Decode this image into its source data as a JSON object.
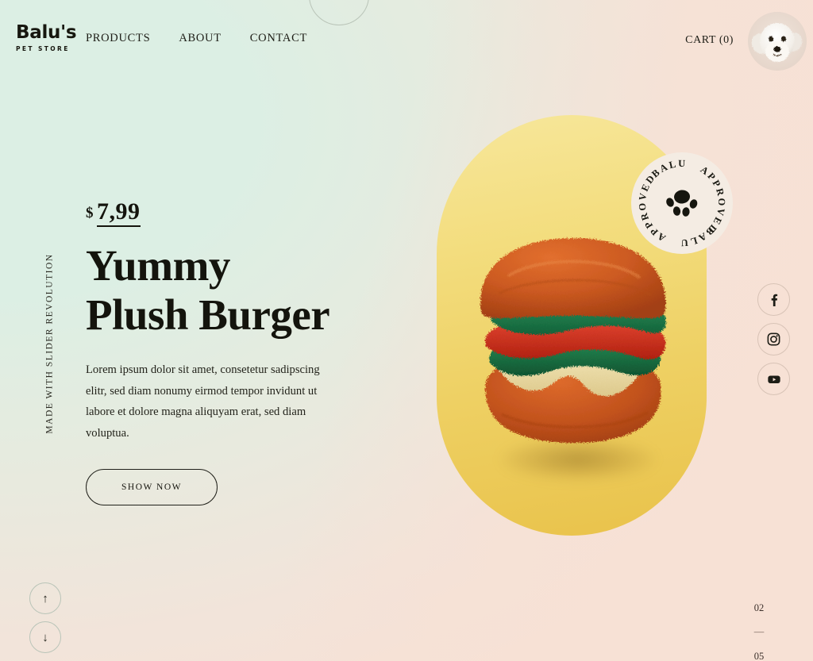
{
  "brand": {
    "logo_main": "Balu's",
    "logo_sub": "PET STORE",
    "paw_icon": "paw-icon"
  },
  "header": {
    "nav": [
      {
        "label": "PRODUCTS"
      },
      {
        "label": "ABOUT"
      },
      {
        "label": "CONTACT"
      }
    ],
    "cart_label": "CART (0)",
    "avatar_alt": "dog-avatar"
  },
  "hero": {
    "side_label": "MADE WITH SLIDER REVOLUTION",
    "currency": "$",
    "price": "7,99",
    "title_line1": "Yummy",
    "title_line2": "Plush Burger",
    "description": "Lorem ipsum dolor sit amet, consetetur sadipscing elitr, sed diam nonumy eirmod tempor invidunt ut labore et dolore magna aliquyam erat, sed diam voluptua.",
    "cta_label": "SHOW NOW",
    "product_alt": "plush-burger-toy"
  },
  "badge": {
    "ring_text": "BALU  •  APPROVED  •  BALU  •  APPROVED  •",
    "ring_word_1": "BALU",
    "ring_word_2": "APPROVED",
    "center_icon": "paw-icon"
  },
  "social": [
    {
      "name": "facebook",
      "glyph": "f"
    },
    {
      "name": "instagram",
      "glyph": "instagram-icon"
    },
    {
      "name": "youtube",
      "glyph": "youtube-icon"
    }
  ],
  "slider": {
    "up_arrow": "↑",
    "down_arrow": "↓",
    "current": "02",
    "separator": "—",
    "total": "05"
  },
  "colors": {
    "bg_left": "#dcefe4",
    "bg_right": "#f7e1d5",
    "pill_yellow": "#eec84f",
    "badge_bg": "#f4ece3",
    "ink": "#14140d",
    "bun": "#c8551f",
    "lettuce": "#1c7a4a",
    "tomato": "#cf2f20",
    "cheese": "#e8d9a8"
  }
}
